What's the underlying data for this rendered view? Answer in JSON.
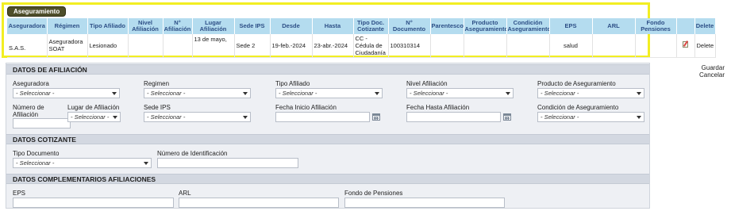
{
  "grid": {
    "title": "Aseguramiento",
    "headers": [
      "Aseguradora",
      "Régimen",
      "Tipo Afiliado",
      "Nivel Afiliación",
      "N° Afiliación",
      "Lugar Afiliación",
      "Sede IPS",
      "Desde",
      "Hasta",
      "Tipo Doc. Cotizante",
      "N° Documento",
      "Parentesco",
      "Producto Aseguramiento",
      "Condición Aseguramiento",
      "EPS",
      "ARL",
      "Fondo Pensiones",
      "",
      "Delete"
    ],
    "row": {
      "aseguradora": "S.A.S.",
      "regimen": "Aseguradora SOAT",
      "tipo_afiliado": "Lesionado",
      "nivel_afiliacion": "",
      "n_afiliacion": "",
      "lugar_afiliacion": "13 de mayo,",
      "sede_ips": "Sede 2",
      "desde": "19-feb.-2024",
      "hasta": "23-abr.-2024",
      "tipo_doc_cotizante": "CC - Cédula de Ciudadanía",
      "n_documento": "100310314",
      "parentesco": "",
      "producto": "",
      "condicion": "",
      "eps": "salud",
      "arl": "",
      "fondo": "",
      "delete": "Delete"
    }
  },
  "actions": {
    "save": "Guardar",
    "cancel": "Cancelar"
  },
  "afiliacion": {
    "header": "DATOS DE AFILIACIÓN",
    "placeholder": "- Seleccionar -",
    "aseguradora_label": "Aseguradora",
    "regimen_label": "Regimen",
    "tipo_afiliado_label": "Tipo Afiliado",
    "nivel_label": "Nivel Afiliación",
    "producto_label": "Producto de Aseguramiento",
    "numero_label": "Número de Afiliación",
    "lugar_label": "Lugar de Afiliación",
    "sede_label": "Sede IPS",
    "fecha_inicio_label": "Fecha Inicio Afiliación",
    "fecha_hasta_label": "Fecha Hasta Afiliación",
    "condicion_label": "Condición de Aseguramiento"
  },
  "cotizante": {
    "header": "DATOS COTIZANTE",
    "tipo_doc_label": "Tipo Documento",
    "num_id_label": "Número de Identificación"
  },
  "complementarios": {
    "header": "DATOS COMPLEMENTARIOS AFILIACIONES",
    "eps_label": "EPS",
    "arl_label": "ARL",
    "fondo_label": "Fondo de Pensiones"
  }
}
